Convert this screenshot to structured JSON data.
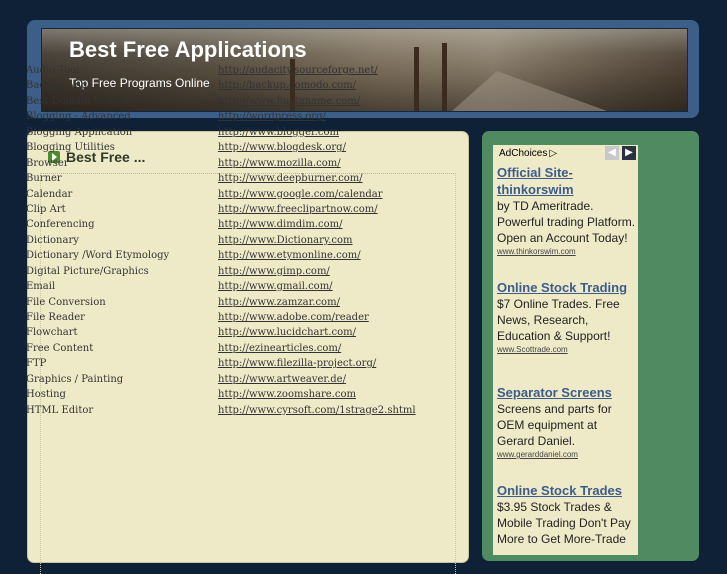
{
  "header": {
    "title": "Best Free Applications",
    "tagline": "Top Free Programs Online"
  },
  "main": {
    "heading": "Best Free ...",
    "apps": [
      {
        "name": "Audio Tool",
        "url": "http://audacity.sourceforge.net/"
      },
      {
        "name": "Backup App",
        "url": "http://backup.comodo.com/"
      },
      {
        "name": "Best Domain Search",
        "url": "http://www.bustaname.com/"
      },
      {
        "name": "Blogging - Advanced",
        "url": "http://wordpress.org/"
      },
      {
        "name": "Blogging Application",
        "url": "http://www.blogger.com"
      },
      {
        "name": "Blogging Utilities",
        "url": "http://www.blogdesk.org/"
      },
      {
        "name": "Browser",
        "url": "http://www.mozilla.com/"
      },
      {
        "name": "Burner",
        "url": "http://www.deepburner.com/"
      },
      {
        "name": "Calendar",
        "url": "http://www.google.com/calendar"
      },
      {
        "name": "Clip Art",
        "url": "http://www.freeclipartnow.com/"
      },
      {
        "name": "Conferencing",
        "url": "http://www.dimdim.com/"
      },
      {
        "name": "Dictionary",
        "url": "http://www.Dictionary.com"
      },
      {
        "name": "Dictionary /Word Etymology",
        "url": "http://www.etymonline.com/"
      },
      {
        "name": "Digital Picture/Graphics",
        "url": "http://www.gimp.com/"
      },
      {
        "name": "Email",
        "url": "http://www.gmail.com/"
      },
      {
        "name": "File Conversion",
        "url": "http://www.zamzar.com/"
      },
      {
        "name": "File Reader",
        "url": "http://www.adobe.com/reader"
      },
      {
        "name": "Flowchart",
        "url": "http://www.lucidchart.com/"
      },
      {
        "name": "Free Content",
        "url": "http://ezinearticles.com/"
      },
      {
        "name": "FTP",
        "url": "http://www.filezilla-project.org/"
      },
      {
        "name": "Graphics / Painting",
        "url": "http://www.artweaver.de/"
      },
      {
        "name": "Hosting",
        "url": "http://www.zoomshare.com"
      },
      {
        "name": "HTML Editor",
        "url": "http://www.cyrsoft.com/1strage2.shtml"
      }
    ]
  },
  "ads": {
    "adchoices_label": "AdChoices",
    "adchoices_icon": "adchoices-triangle-icon",
    "items": [
      {
        "title": "Official Site- thinkorswim",
        "text": "by TD Ameritrade. Powerful trading Platform. Open an Account Today!",
        "url": "www.thinkorswim.com"
      },
      {
        "title": "Online Stock Trading",
        "text": "$7 Online Trades. Free News, Research, Education & Support!",
        "url": "www.Scottrade.com"
      },
      {
        "title": "Separator Screens",
        "text": "Screens and parts for OEM equipment at Gerard Daniel.",
        "url": "www.gerarddaniel.com"
      },
      {
        "title": "Online Stock Trades",
        "text": "$3.95 Stock Trades & Mobile Trading Don't Pay More to Get More-Trade",
        "url": ""
      }
    ]
  },
  "colors": {
    "page_background": "#0f2136",
    "header_frame": "#3b5f88",
    "main_panel": "#eeeac8",
    "ad_panel": "#4f8a61",
    "ad_title": "#3d5c8a"
  }
}
